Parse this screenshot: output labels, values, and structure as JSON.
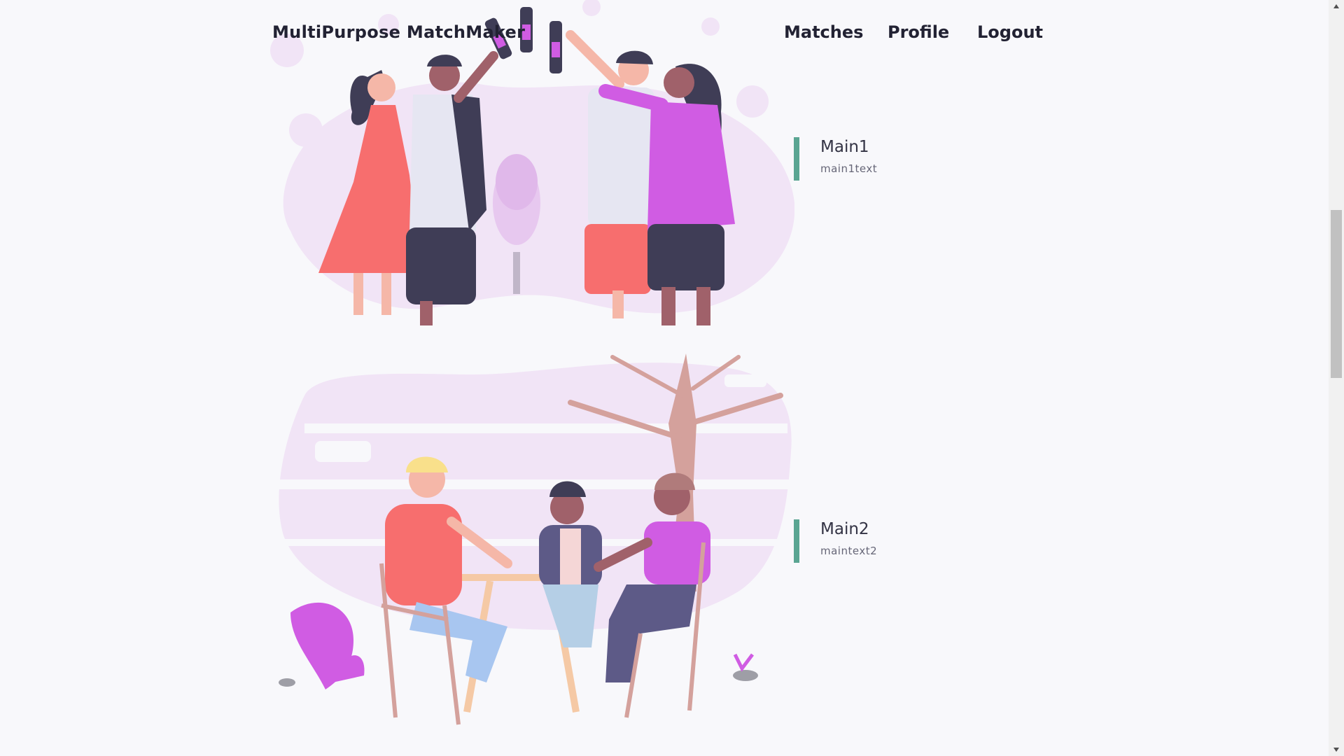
{
  "navbar": {
    "brand": "MultiPurpose MatchMaker",
    "links": [
      {
        "label": "Matches"
      },
      {
        "label": "Profile"
      },
      {
        "label": "Logout"
      }
    ]
  },
  "features": [
    {
      "title": "Main1",
      "text": "main1text"
    },
    {
      "title": "Main2",
      "text": "maintext2"
    }
  ],
  "colors": {
    "accent": "#5aa592",
    "purple": "#d05ce3",
    "coral": "#f76e6e",
    "blob": "#f1e4f6",
    "dark": "#3f3d56",
    "skin_light": "#f5b7a8",
    "skin_dark": "#a0616a"
  },
  "illustrations": [
    {
      "name": "friends-toasting-illustration"
    },
    {
      "name": "friends-at-cafe-table-illustration"
    }
  ]
}
